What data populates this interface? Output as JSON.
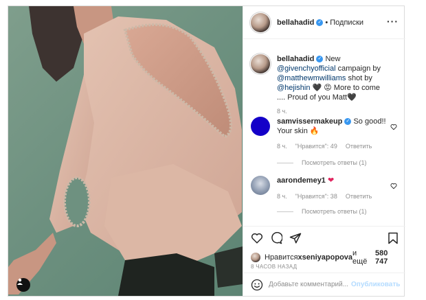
{
  "post": {
    "author": "bellahadid",
    "follow_dot": "•",
    "follow_label": "Подписки",
    "more_label": "···"
  },
  "caption": {
    "author": "bellahadid",
    "text_1": " New ",
    "mention_1": "@givenchyofficial",
    "text_2": " campaign by ",
    "mention_2": "@matthewmwilliams",
    "text_3": " shot by ",
    "mention_3": "@hejishin",
    "text_4": " 🖤 😡 More to come .... Proud of you Matt🖤",
    "time": "8 ч."
  },
  "comments": [
    {
      "author": "samvissermakeup",
      "text": " So good!! Your skin 🔥",
      "time": "8 ч.",
      "likes": "\"Нравится\": 49",
      "reply": "Ответить",
      "replies": "Посмотреть ответы (1)"
    },
    {
      "author": "aarondemey1",
      "text": " ❤",
      "time": "8 ч.",
      "likes": "\"Нравится\": 38",
      "reply": "Ответить",
      "replies": "Посмотреть ответы (1)"
    }
  ],
  "likes_bar": {
    "prefix": "Нравится ",
    "user": "xseniyapopova",
    "middle": " и ещё ",
    "count": "580 747"
  },
  "time_ago": "8 ЧАСОВ НАЗАД",
  "add_comment": {
    "placeholder": "Добавьте комментарий...",
    "publish": "Опубликовать"
  },
  "colors": {
    "verified": "#3897f0",
    "link": "#00376b",
    "publish_disabled": "#b3dbff"
  }
}
